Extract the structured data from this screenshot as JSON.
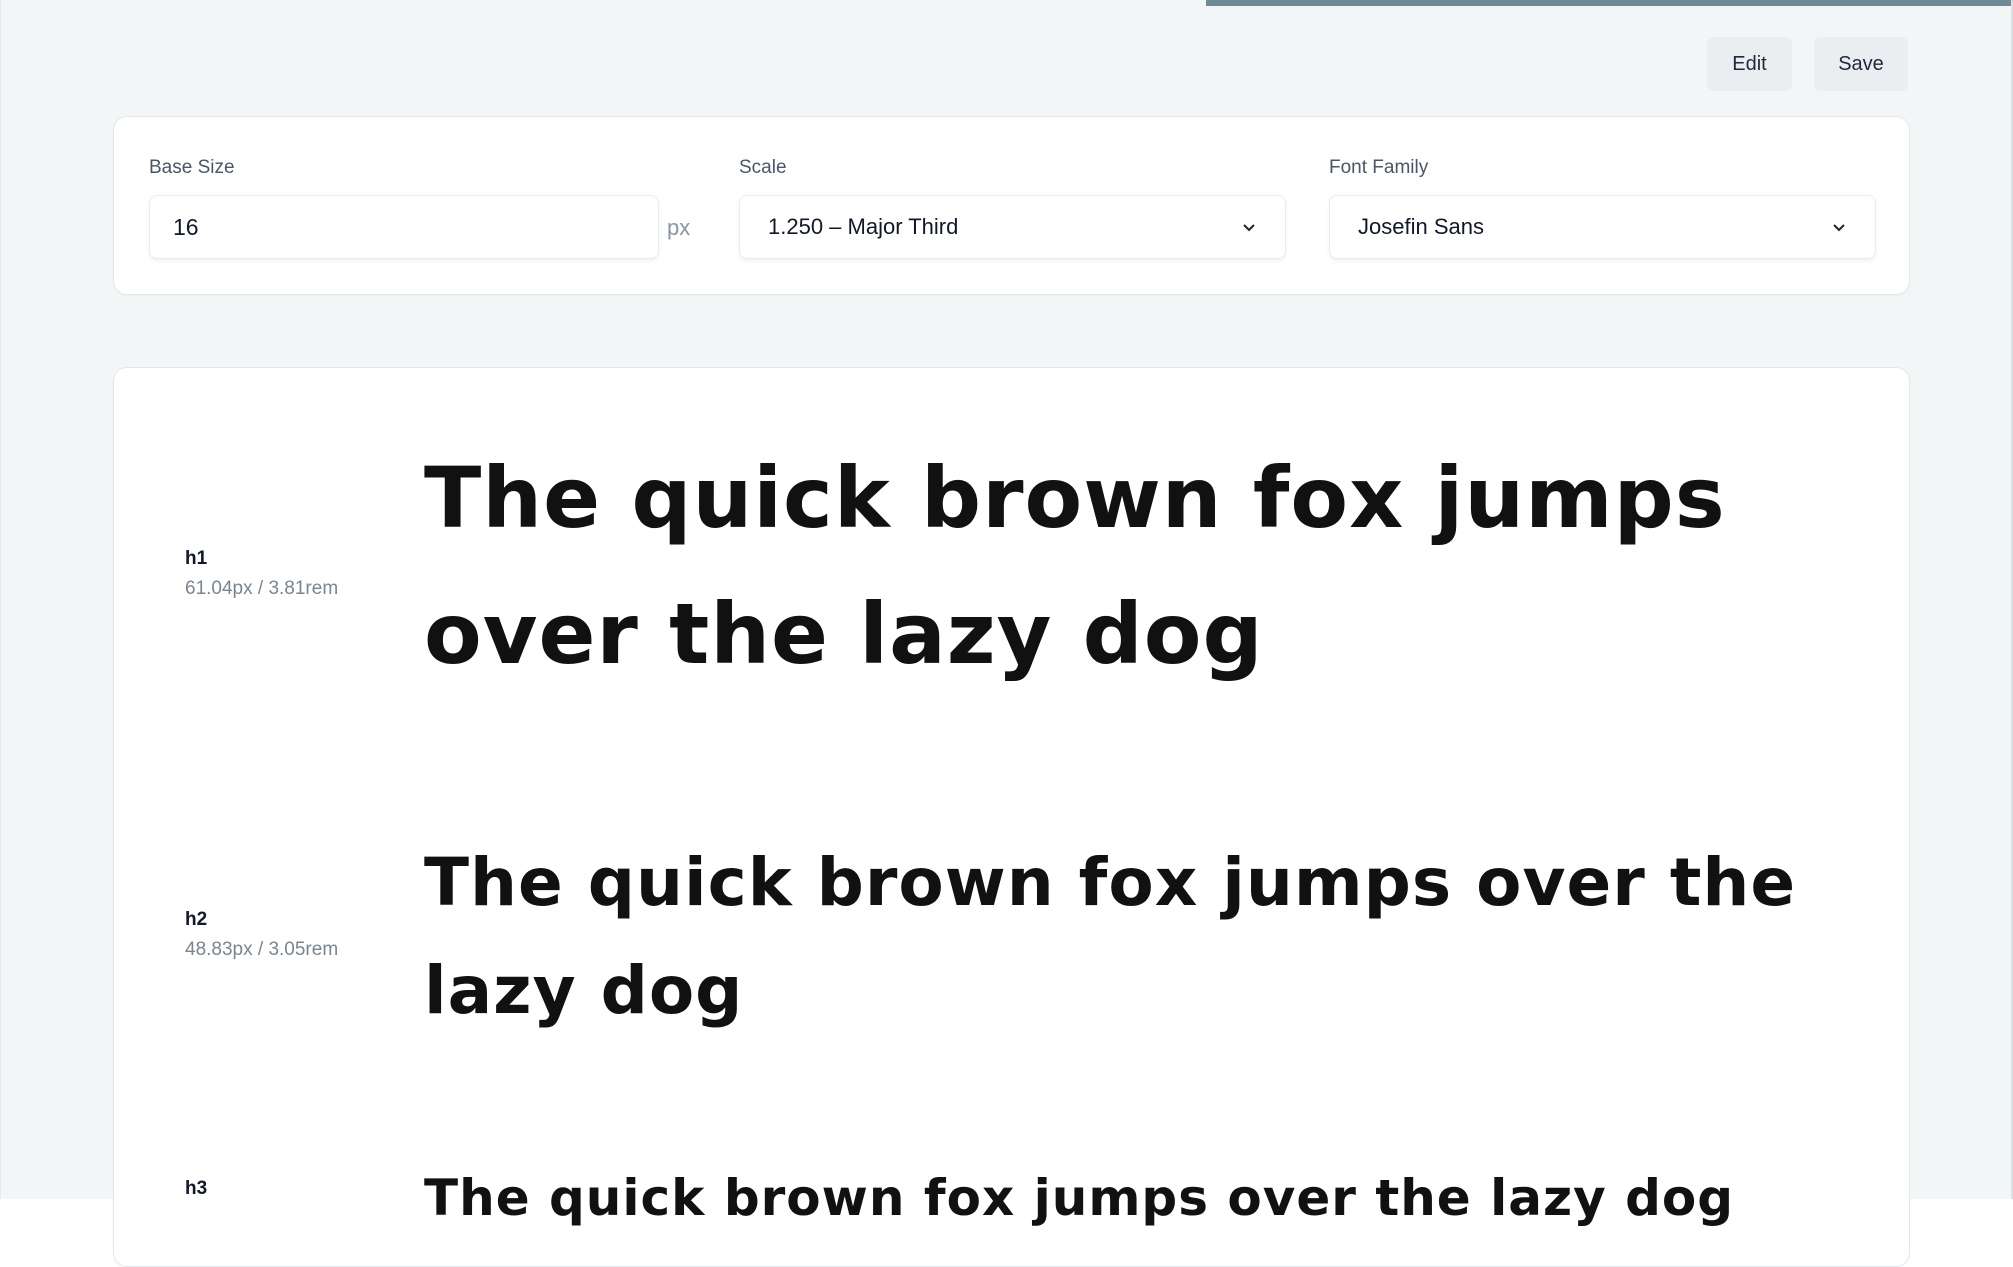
{
  "toolbar": {
    "edit_label": "Edit",
    "save_label": "Save"
  },
  "progress": {
    "fraction": 0.4
  },
  "settings": {
    "base_size": {
      "label": "Base Size",
      "value": "16",
      "unit": "px"
    },
    "scale": {
      "label": "Scale",
      "selected": "1.250 – Major Third"
    },
    "font_family": {
      "label": "Font Family",
      "selected": "Josefin Sans"
    }
  },
  "preview": {
    "rows": [
      {
        "tag": "h1",
        "meta": "61.04px / 3.81rem",
        "sample": "The quick brown fox jumps over the lazy dog"
      },
      {
        "tag": "h2",
        "meta": "48.83px / 3.05rem",
        "sample": "The quick brown fox jumps over the lazy dog"
      },
      {
        "tag": "h3",
        "meta": "",
        "sample": "The quick brown fox jumps over the lazy dog"
      }
    ]
  },
  "icons": {
    "select_chevron": "chevron-down-icon"
  },
  "colors": {
    "background": "#f3f6f7",
    "card": "#ffffff",
    "button_bg": "#eaeef1",
    "progress": "#6f8a96"
  }
}
